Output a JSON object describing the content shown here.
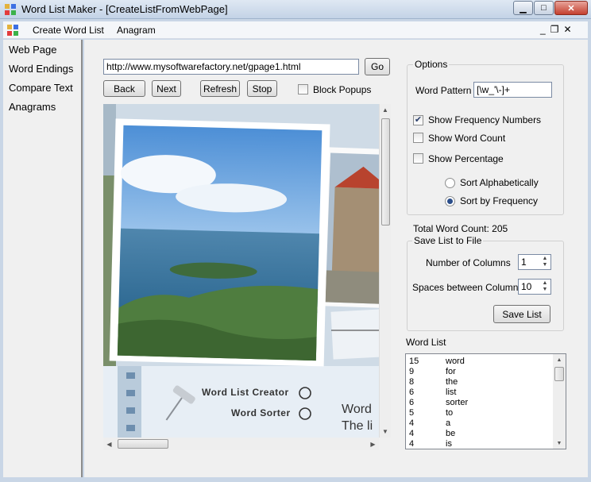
{
  "window": {
    "title": "Word List Maker - [CreateListFromWebPage]"
  },
  "menu": {
    "items": [
      "Create Word List",
      "Anagram"
    ]
  },
  "nav": {
    "items": [
      "Web Page",
      "Word Endings",
      "Compare Text",
      "Anagrams"
    ]
  },
  "browser": {
    "url": "http://www.mysoftwarefactory.net/gpage1.html",
    "go_label": "Go",
    "back_label": "Back",
    "next_label": "Next",
    "refresh_label": "Refresh",
    "stop_label": "Stop",
    "block_popups_label": "Block Popups",
    "block_popups_checked": false,
    "page_links": [
      "Word List Creator",
      "Word Sorter"
    ],
    "page_heading_partial": [
      "Word",
      "The li"
    ]
  },
  "options": {
    "title": "Options",
    "word_pattern_label": "Word Pattern",
    "word_pattern_value": "[\\w_'\\-]+",
    "show_frequency_label": "Show Frequency Numbers",
    "show_frequency_checked": true,
    "show_word_count_label": "Show Word Count",
    "show_word_count_checked": false,
    "show_percentage_label": "Show Percentage",
    "show_percentage_checked": false,
    "sort_alpha_label": "Sort Alphabetically",
    "sort_freq_label": "Sort by Frequency",
    "sort_selected": "frequency"
  },
  "total_word_count": "Total Word Count: 205",
  "save": {
    "title": "Save List to File",
    "columns_label": "Number of Columns",
    "columns_value": "1",
    "spaces_label": "Spaces between Columns",
    "spaces_value": "10",
    "save_button": "Save List"
  },
  "word_list": {
    "label": "Word List",
    "rows": [
      {
        "count": "15",
        "word": "word"
      },
      {
        "count": "9",
        "word": "for"
      },
      {
        "count": "8",
        "word": "the"
      },
      {
        "count": "6",
        "word": "list"
      },
      {
        "count": "6",
        "word": "sorter"
      },
      {
        "count": "5",
        "word": "to"
      },
      {
        "count": "4",
        "word": "a"
      },
      {
        "count": "4",
        "word": "be"
      },
      {
        "count": "4",
        "word": "is"
      }
    ]
  },
  "colors": {
    "accent": "#2a4d8a",
    "titlebar": "#c3d3e6",
    "panel": "#f0f0f0"
  }
}
